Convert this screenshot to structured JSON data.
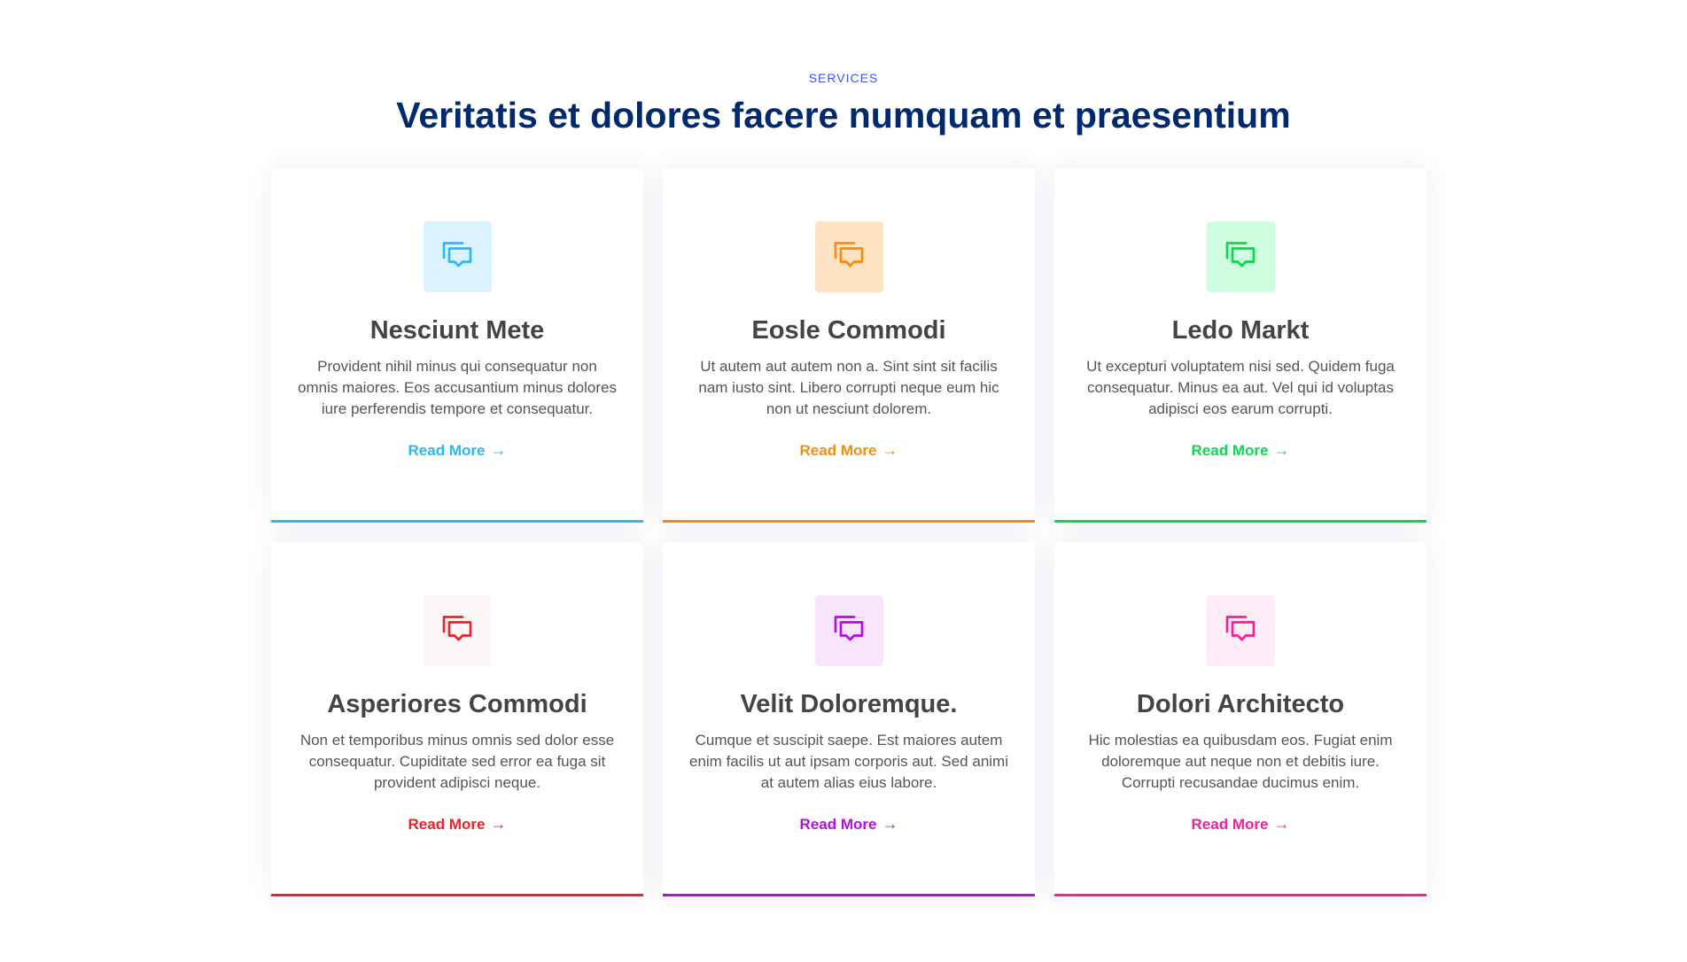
{
  "section": {
    "eyebrow": "SERVICES",
    "heading": "Veritatis et dolores facere numquam et praesentium"
  },
  "cards": [
    {
      "title": "Nesciunt Mete",
      "text": "Provident nihil minus qui consequatur non omnis maiores. Eos accusantium minus dolores iure perferendis tempore et consequatur.",
      "link": "Read More",
      "icon": "chat-icon",
      "color": "#2db6fa",
      "bg": "#dbf3fe"
    },
    {
      "title": "Eosle Commodi",
      "text": "Ut autem aut autem non a. Sint sint sit facilis nam iusto sint. Libero corrupti neque eum hic non ut nesciunt dolorem.",
      "link": "Read More",
      "icon": "chat-icon",
      "color": "#f68c09",
      "bg": "#fde3c4"
    },
    {
      "title": "Ledo Markt",
      "text": "Ut excepturi voluptatem nisi sed. Quidem fuga consequatur. Minus ea aut. Vel qui id voluptas adipisci eos earum corrupti.",
      "link": "Read More",
      "icon": "chat-icon",
      "color": "#08da4e",
      "bg": "#cffddf"
    },
    {
      "title": "Asperiores Commodi",
      "text": "Non et temporibus minus omnis sed dolor esse consequatur. Cupiditate sed error ea fuga sit provident adipisci neque.",
      "link": "Read More",
      "icon": "chat-icon",
      "color": "#e9222c",
      "bg": "#fef7f8"
    },
    {
      "title": "Velit Doloremque.",
      "text": "Cumque et suscipit saepe. Est maiores autem enim facilis ut aut ipsam corporis aut. Sed animi at autem alias eius labore.",
      "link": "Read More",
      "icon": "chat-icon",
      "color": "#b50edf",
      "bg": "#f8e4fd"
    },
    {
      "title": "Dolori Architecto",
      "text": "Hic molestias ea quibusdam eos. Fugiat enim doloremque aut neque non et debitis iure. Corrupti recusandae ducimus enim.",
      "link": "Read More",
      "icon": "chat-icon",
      "color": "#f51f9c",
      "bg": "#feecf7"
    }
  ]
}
